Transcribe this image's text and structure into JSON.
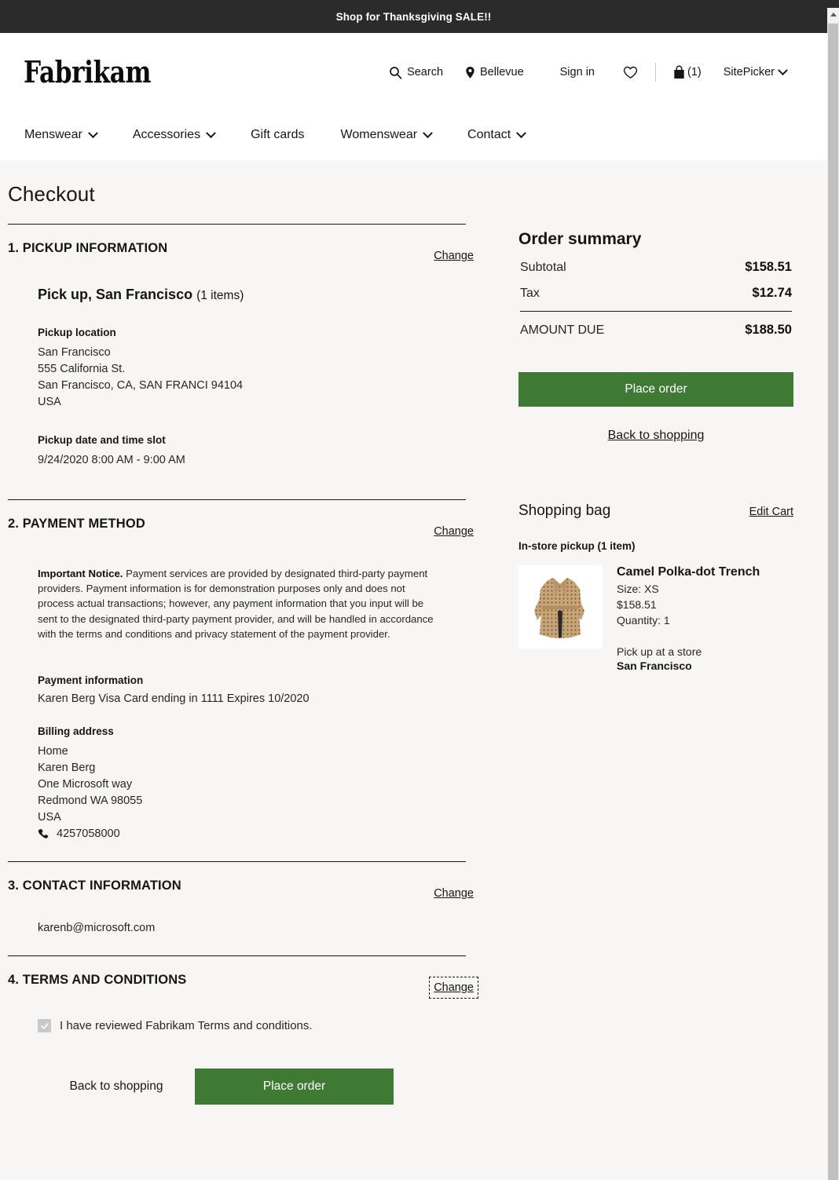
{
  "promo": {
    "text": "Shop for Thanksgiving SALE!!"
  },
  "header": {
    "brand": "Fabrikam",
    "utils": {
      "search": "Search",
      "location": "Bellevue",
      "signin": "Sign in",
      "bag_count": "(1)",
      "sitepicker": "SitePicker"
    },
    "nav": [
      {
        "label": "Menswear",
        "has_chevron": true
      },
      {
        "label": "Accessories",
        "has_chevron": true
      },
      {
        "label": "Gift cards",
        "has_chevron": false
      },
      {
        "label": "Womenswear",
        "has_chevron": true
      },
      {
        "label": "Contact",
        "has_chevron": true
      }
    ]
  },
  "page": {
    "title": "Checkout"
  },
  "sections": {
    "pickup": {
      "number_title": "1. PICKUP INFORMATION",
      "change_label": "Change",
      "heading": "Pick up, San Francisco",
      "items_count": "(1 items)",
      "location_label": "Pickup location",
      "address": [
        "San Francisco",
        "555 California St.",
        "San Francisco, CA, SAN FRANCI 94104",
        "USA"
      ],
      "slot_label": "Pickup date and time slot",
      "slot_value": "9/24/2020 8:00 AM - 9:00 AM"
    },
    "payment": {
      "number_title": "2. PAYMENT METHOD",
      "change_label": "Change",
      "notice_bold": "Important Notice.",
      "notice_text": " Payment services are provided by designated third-party payment providers.  Payment information is for demonstration purposes only and does not process actual transactions; however, any payment information that you input will be sent to the designated third-party payment provider, and will be handled in accordance with the terms and conditions and privacy statement of the payment provider.",
      "info_label": "Payment information",
      "info_value": "Karen Berg   Visa   Card ending in 1111   Expires 10/2020",
      "billing_label": "Billing address",
      "billing_lines": [
        "Home",
        "Karen Berg",
        "One Microsoft way",
        "Redmond WA  98055",
        "USA"
      ],
      "phone": "4257058000"
    },
    "contact": {
      "number_title": "3. CONTACT INFORMATION",
      "change_label": "Change",
      "email": "karenb@microsoft.com"
    },
    "terms": {
      "number_title": "4. TERMS AND CONDITIONS",
      "change_label": "Change",
      "checkbox_label": "I have reviewed Fabrikam Terms and conditions.",
      "checkbox_checked": true,
      "back_label": "Back to shopping",
      "place_order_label": "Place order"
    }
  },
  "order_summary": {
    "title": "Order summary",
    "rows": [
      {
        "label": "Subtotal",
        "amount": "$158.51"
      },
      {
        "label": "Tax",
        "amount": "$12.74"
      }
    ],
    "total": {
      "label": "AMOUNT DUE",
      "amount": "$188.50"
    },
    "place_order_label": "Place order",
    "back_label": "Back to shopping"
  },
  "shopping_bag": {
    "title": "Shopping bag",
    "edit_label": "Edit Cart",
    "group_label": "In-store pickup (1 item)",
    "item": {
      "name": "Camel Polka-dot Trench",
      "size": "Size: XS",
      "price": "$158.51",
      "quantity": "Quantity: 1",
      "pickup_note": "Pick up at a store",
      "pickup_store": "San Francisco",
      "image_alt": "camel-polka-dot-trench-coat"
    }
  },
  "colors": {
    "accent_green": "#3f7a34",
    "promo_bar": "#2b2b2b",
    "page_bg": "#f7f6f4"
  }
}
